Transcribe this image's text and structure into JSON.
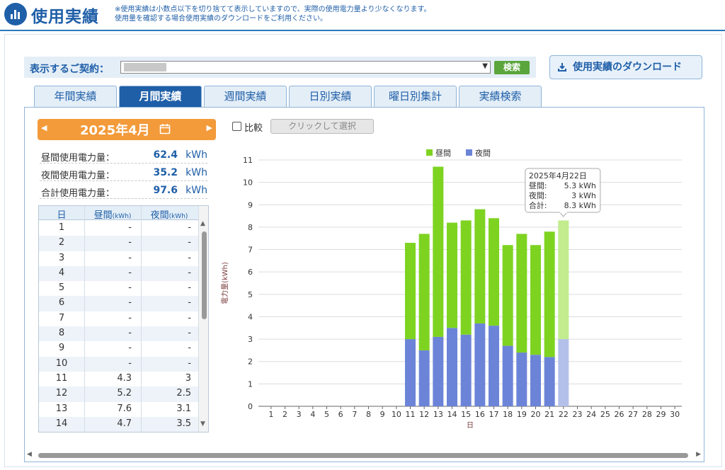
{
  "header": {
    "title": "使用実績",
    "icon": "bar-chart-icon",
    "note_line1": "※使用実績は小数点以下を切り捨てて表示していますので、実際の使用電力量より少なくなります。",
    "note_line2": "使用量を確認する場合使用実績のダウンロードをご利用ください。"
  },
  "contract": {
    "label": "表示するご契約：",
    "search_label": "検索"
  },
  "download": {
    "label": "使用実績のダウンロード",
    "icon": "download-icon"
  },
  "tabs": [
    {
      "label": "年間実績",
      "active": false
    },
    {
      "label": "月間実績",
      "active": true
    },
    {
      "label": "週間実績",
      "active": false
    },
    {
      "label": "日別実績",
      "active": false
    },
    {
      "label": "曜日別集計",
      "active": false
    },
    {
      "label": "実績検索",
      "active": false
    }
  ],
  "month_selector": {
    "prev": "◀",
    "label": "2025年4月",
    "next": "▶",
    "icon": "calendar-icon"
  },
  "compare": {
    "label": "比較",
    "pick_label": "クリックして選択"
  },
  "summary": [
    {
      "label": "昼間使用電力量：",
      "value": "62.4",
      "unit": "kWh"
    },
    {
      "label": "夜間使用電力量：",
      "value": "35.2",
      "unit": "kWh"
    },
    {
      "label": "合計使用電力量：",
      "value": "97.6",
      "unit": "kWh"
    }
  ],
  "table": {
    "headers": {
      "day": "日",
      "daytime": "昼間",
      "night": "夜間",
      "unit": "(kWh)"
    },
    "rows": [
      {
        "day": "1",
        "daytime": "-",
        "night": "-"
      },
      {
        "day": "2",
        "daytime": "-",
        "night": "-"
      },
      {
        "day": "3",
        "daytime": "-",
        "night": "-"
      },
      {
        "day": "4",
        "daytime": "-",
        "night": "-"
      },
      {
        "day": "5",
        "daytime": "-",
        "night": "-"
      },
      {
        "day": "6",
        "daytime": "-",
        "night": "-"
      },
      {
        "day": "7",
        "daytime": "-",
        "night": "-"
      },
      {
        "day": "8",
        "daytime": "-",
        "night": "-"
      },
      {
        "day": "9",
        "daytime": "-",
        "night": "-"
      },
      {
        "day": "10",
        "daytime": "-",
        "night": "-"
      },
      {
        "day": "11",
        "daytime": "4.3",
        "night": "3"
      },
      {
        "day": "12",
        "daytime": "5.2",
        "night": "2.5"
      },
      {
        "day": "13",
        "daytime": "7.6",
        "night": "3.1"
      },
      {
        "day": "14",
        "daytime": "4.7",
        "night": "3.5"
      }
    ]
  },
  "colors": {
    "brand": "#1f5fa8",
    "daytime": "#7ed321",
    "night": "#6c84d8",
    "daytime_highlight": "#c2ec8e",
    "night_highlight": "#b3c0ea",
    "month_button": "#f39a3a"
  },
  "chart_data": {
    "type": "bar",
    "stacked": true,
    "ylabel": "電力量(kWh)",
    "xlabel": "日",
    "ylim": [
      0,
      11
    ],
    "yticks": [
      "0",
      "1",
      "2",
      "3",
      "4",
      "5",
      "6",
      "7",
      "8",
      "9",
      "10",
      "11"
    ],
    "grid": true,
    "legend_position": "top",
    "categories": [
      "1",
      "2",
      "3",
      "4",
      "5",
      "6",
      "7",
      "8",
      "9",
      "10",
      "11",
      "12",
      "13",
      "14",
      "15",
      "16",
      "17",
      "18",
      "19",
      "20",
      "21",
      "22",
      "23",
      "24",
      "25",
      "26",
      "27",
      "28",
      "29",
      "30"
    ],
    "series": [
      {
        "name": "昼間",
        "values": [
          null,
          null,
          null,
          null,
          null,
          null,
          null,
          null,
          null,
          null,
          4.3,
          5.2,
          7.6,
          4.7,
          5.1,
          5.1,
          4.8,
          4.5,
          5.3,
          4.9,
          5.6,
          5.3,
          null,
          null,
          null,
          null,
          null,
          null,
          null,
          null
        ]
      },
      {
        "name": "夜間",
        "values": [
          null,
          null,
          null,
          null,
          null,
          null,
          null,
          null,
          null,
          null,
          3,
          2.5,
          3.1,
          3.5,
          3.2,
          3.7,
          3.6,
          2.7,
          2.4,
          2.3,
          2.2,
          3,
          null,
          null,
          null,
          null,
          null,
          null,
          null,
          null
        ]
      }
    ],
    "highlight_day": "22",
    "tooltip": {
      "title": "2025年4月22日",
      "rows": [
        {
          "label": "昼間:",
          "value": "5.3 kWh"
        },
        {
          "label": "夜間:",
          "value": "3 kWh"
        },
        {
          "label": "合計:",
          "value": "8.3 kWh"
        }
      ]
    }
  }
}
